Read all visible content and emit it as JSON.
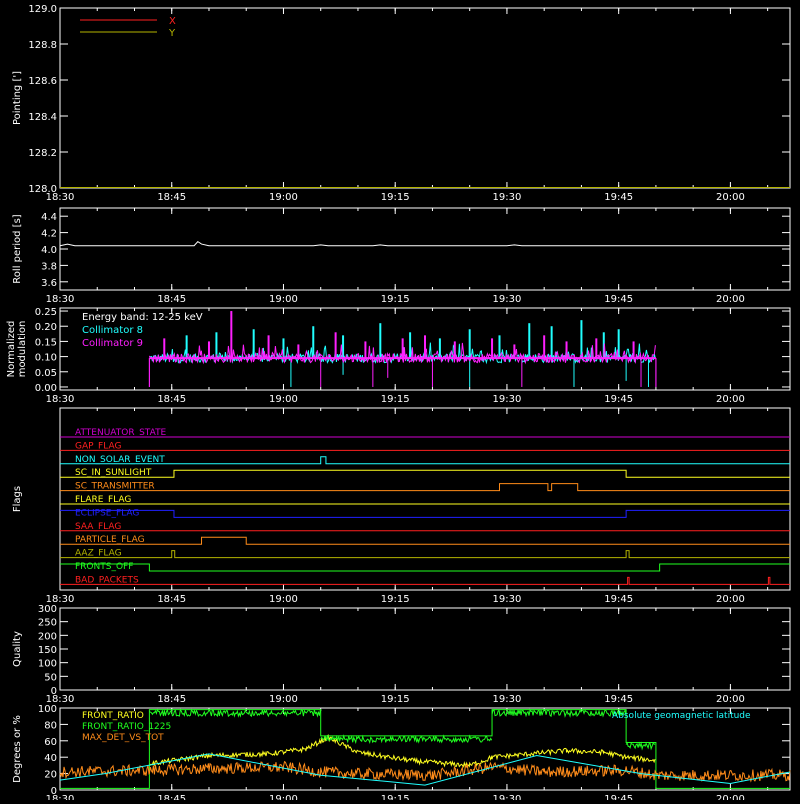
{
  "colors": {
    "background": "#000000",
    "axis": "#ffffff",
    "red": "#ff2020",
    "olive": "#b4b400",
    "cyan": "#20ffff",
    "magenta": "#ff20ff",
    "orange": "#ff8c1a",
    "yellow": "#ffff20",
    "blue": "#2020ff",
    "green": "#20ff20",
    "brown_orange": "#d47a2a",
    "purple": "#d000d0"
  },
  "chart_data": [
    {
      "type": "line",
      "ylabel": "Pointing [']",
      "xlim": [
        "18:30",
        "20:08"
      ],
      "xticks": [
        "18:30",
        "18:45",
        "19:00",
        "19:15",
        "19:30",
        "19:45",
        "20:00"
      ],
      "ylim": [
        128.0,
        129.0
      ],
      "yticks": [
        "128.0",
        "128.2",
        "128.4",
        "128.6",
        "128.8",
        "129.0"
      ],
      "legend": "top-left",
      "series": [
        {
          "name": "X",
          "color": "#ff2020",
          "x": [
            "18:30",
            "20:08"
          ],
          "values": [
            128.0,
            128.0
          ]
        },
        {
          "name": "Y",
          "color": "#b4b400",
          "x": [
            "18:30",
            "20:08"
          ],
          "values": [
            128.0,
            128.0
          ]
        }
      ]
    },
    {
      "type": "line",
      "ylabel": "Roll period [s]",
      "xlim": [
        "18:30",
        "20:08"
      ],
      "xticks": [
        "18:30",
        "18:45",
        "19:00",
        "19:15",
        "19:30",
        "19:45",
        "20:00"
      ],
      "ylim": [
        3.5,
        4.5
      ],
      "yticks": [
        "3.6",
        "3.8",
        "4.0",
        "4.2",
        "4.4"
      ],
      "series": [
        {
          "color": "#ffffff",
          "x": [
            "18:30",
            "18:31",
            "18:32",
            "18:48",
            "18:48.5",
            "18:49",
            "18:50",
            "19:04",
            "19:05",
            "19:06",
            "19:12",
            "19:13",
            "19:14",
            "19:30",
            "19:31",
            "19:32",
            "20:08"
          ],
          "values": [
            4.04,
            4.06,
            4.04,
            4.04,
            4.09,
            4.06,
            4.04,
            4.04,
            4.05,
            4.04,
            4.04,
            4.05,
            4.04,
            4.04,
            4.05,
            4.04,
            4.04
          ]
        }
      ]
    },
    {
      "type": "line",
      "ylabel": "Normalized modulation",
      "ylabel_lines": [
        "Normalized",
        "modulation"
      ],
      "xlim": [
        "18:30",
        "20:08"
      ],
      "xticks": [
        "18:30",
        "18:45",
        "19:00",
        "19:15",
        "19:30",
        "19:45",
        "20:00"
      ],
      "ylim": [
        -0.01,
        0.26
      ],
      "yticks": [
        "0.00",
        "0.05",
        "0.10",
        "0.15",
        "0.20",
        "0.25"
      ],
      "annotation": "Energy band: 12-25 keV",
      "legend": "top-left",
      "data_window": [
        "18:42",
        "19:50"
      ],
      "baseline": 0.095,
      "series": [
        {
          "name": "Collimator 8",
          "color": "#20ffff",
          "spikes_x": [
            "18:47",
            "18:51",
            "18:56",
            "19:00",
            "19:04",
            "19:08",
            "19:13",
            "19:17",
            "19:21",
            "19:25",
            "19:29",
            "19:33",
            "19:36",
            "19:40",
            "19:43",
            "19:45"
          ],
          "spikes_y": [
            0.17,
            0.18,
            0.19,
            0.16,
            0.2,
            0.17,
            0.21,
            0.18,
            0.16,
            0.19,
            0.17,
            0.21,
            0.2,
            0.22,
            0.18,
            0.19
          ],
          "dips_x": [
            "19:01",
            "19:08",
            "19:25",
            "19:39",
            "19:46",
            "19:49"
          ],
          "dips_y": [
            0.0,
            0.04,
            0.0,
            0.0,
            0.02,
            0.0
          ]
        },
        {
          "name": "Collimator 9",
          "color": "#ff20ff",
          "spikes_x": [
            "18:44",
            "18:50",
            "18:53",
            "18:58",
            "19:02",
            "19:07",
            "19:11",
            "19:16",
            "19:19",
            "19:23",
            "19:28",
            "19:31",
            "19:35",
            "19:38",
            "19:42",
            "19:47"
          ],
          "spikes_y": [
            0.16,
            0.15,
            0.25,
            0.17,
            0.14,
            0.18,
            0.15,
            0.16,
            0.17,
            0.15,
            0.16,
            0.14,
            0.17,
            0.15,
            0.16,
            0.15
          ],
          "dips_x": [
            "19:05",
            "19:12",
            "19:14",
            "19:20",
            "19:32",
            "19:48"
          ],
          "dips_y": [
            0.0,
            0.0,
            0.03,
            0.0,
            0.0,
            0.0
          ]
        }
      ]
    },
    {
      "type": "line",
      "ylabel": "Flags",
      "xlim": [
        "18:30",
        "20:08"
      ],
      "xticks": [
        "18:30",
        "18:45",
        "19:00",
        "19:15",
        "19:30",
        "19:45",
        "20:00"
      ],
      "flags": [
        {
          "name": "ATTENUATOR_STATE",
          "color": "#d000d0",
          "on": []
        },
        {
          "name": "GAP_FLAG",
          "color": "#ff2020",
          "on": []
        },
        {
          "name": "NON_SOLAR_EVENT",
          "color": "#20ffff",
          "on": [
            [
              "19:05",
              "19:05.7"
            ]
          ]
        },
        {
          "name": "SC_IN_SUNLIGHT",
          "color": "#ffff20",
          "on": [
            [
              "18:45.3",
              "19:46"
            ]
          ]
        },
        {
          "name": "SC_TRANSMITTER",
          "color": "#ff8c1a",
          "on": [
            [
              "19:29",
              "19:35.5"
            ],
            [
              "19:36",
              "19:39.5"
            ]
          ]
        },
        {
          "name": "FLARE_FLAG",
          "color": "#ffff20",
          "on": []
        },
        {
          "name": "ECLIPSE_FLAG",
          "color": "#2020ff",
          "on": [
            [
              "18:30",
              "18:45.3"
            ],
            [
              "19:46",
              "20:08"
            ]
          ]
        },
        {
          "name": "SAA_FLAG",
          "color": "#ff2020",
          "on": []
        },
        {
          "name": "PARTICLE_FLAG",
          "color": "#ff8c1a",
          "on": [
            [
              "18:49",
              "18:55"
            ]
          ]
        },
        {
          "name": "AAZ_FLAG",
          "color": "#b4b400",
          "on": [
            [
              "18:45",
              "18:45.4"
            ],
            [
              "19:46",
              "19:46.4"
            ]
          ]
        },
        {
          "name": "FRONTS_OFF",
          "color": "#20ff20",
          "on": [
            [
              "18:30",
              "18:42"
            ],
            [
              "19:50.5",
              "20:08"
            ]
          ]
        },
        {
          "name": "BAD_PACKETS",
          "color": "#ff2020",
          "on": [
            [
              "19:46.2",
              "19:46.4"
            ],
            [
              "20:05.1",
              "20:05.3"
            ]
          ]
        }
      ]
    },
    {
      "type": "line",
      "ylabel": "Quality",
      "xlim": [
        "18:30",
        "20:08"
      ],
      "xticks": [
        "18:30",
        "18:45",
        "19:00",
        "19:15",
        "19:30",
        "19:45",
        "20:00"
      ],
      "ylim": [
        0,
        300
      ],
      "yticks": [
        "0",
        "50",
        "100",
        "150",
        "200",
        "250",
        "300"
      ],
      "series": []
    },
    {
      "type": "line",
      "ylabel": "Degrees or %",
      "xlim": [
        "18:30",
        "20:08"
      ],
      "xticks": [
        "18:30",
        "18:45",
        "19:00",
        "19:15",
        "19:30",
        "19:45",
        "20:00"
      ],
      "ylim": [
        0,
        100
      ],
      "yticks": [
        "0",
        "20",
        "40",
        "60",
        "80",
        "100"
      ],
      "legend": "top-left",
      "series": [
        {
          "name": "FRONT_RATIO",
          "color": "#ffff20",
          "x": [
            "18:42",
            "18:50",
            "18:58",
            "19:03",
            "19:06",
            "19:10",
            "19:14",
            "19:18",
            "19:22",
            "19:25",
            "19:27",
            "19:28",
            "19:33",
            "19:38",
            "19:43",
            "19:46",
            "19:50"
          ],
          "values": [
            32,
            42,
            44,
            50,
            64,
            46,
            40,
            35,
            32,
            30,
            36,
            40,
            44,
            48,
            46,
            40,
            36
          ]
        },
        {
          "name": "FRONT_RATIO_1225",
          "color": "#20ff20",
          "x": [
            "18:30",
            "18:42",
            "18:42",
            "19:05",
            "19:05",
            "19:28",
            "19:28",
            "19:46",
            "19:46",
            "19:50",
            "19:50",
            "20:08"
          ],
          "values": [
            2,
            2,
            98,
            98,
            66,
            66,
            98,
            98,
            58,
            58,
            2,
            2
          ]
        },
        {
          "name": "MAX_DET_VS_TOT",
          "color": "#ff8c1a",
          "x": [
            "18:30",
            "18:42",
            "18:50",
            "19:00",
            "19:05",
            "19:10",
            "19:20",
            "19:28",
            "19:35",
            "19:46",
            "19:50",
            "20:08"
          ],
          "values": [
            22,
            24,
            26,
            28,
            22,
            20,
            18,
            28,
            22,
            24,
            18,
            18
          ]
        },
        {
          "name": "Absolute geomagnetic latitude",
          "color": "#20ffff",
          "x": [
            "18:30",
            "18:36",
            "18:50",
            "19:05",
            "19:19",
            "19:34",
            "19:48",
            "20:00",
            "20:08"
          ],
          "values": [
            12,
            20,
            44,
            18,
            6,
            42,
            20,
            8,
            22
          ]
        }
      ]
    }
  ]
}
